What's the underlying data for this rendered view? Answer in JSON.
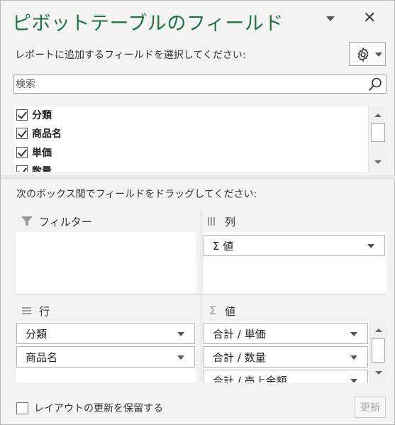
{
  "header": {
    "title": "ピボットテーブルのフィールド",
    "close_glyph": "✕"
  },
  "subtitle": "レポートに追加するフィールドを選択してください:",
  "search": {
    "placeholder": "検索"
  },
  "field_list": [
    {
      "label": "分類",
      "checked": true
    },
    {
      "label": "商品名",
      "checked": true
    },
    {
      "label": "単価",
      "checked": true
    },
    {
      "label": "数量",
      "checked": true
    }
  ],
  "drag_hint": "次のボックス間でフィールドをドラッグしてください:",
  "areas": {
    "filters": {
      "label": "フィルター",
      "icon": "filter-icon",
      "items": []
    },
    "columns": {
      "label": "列",
      "icon": "columns-icon",
      "items": [
        "Σ 値"
      ]
    },
    "rows": {
      "label": "行",
      "icon": "rows-icon",
      "items": [
        "分類",
        "商品名"
      ]
    },
    "values": {
      "label": "値",
      "icon": "sigma-icon",
      "sigma": "Σ",
      "items": [
        "合計 / 単価",
        "合計 / 数量",
        "合計 / 売上金額"
      ]
    }
  },
  "footer": {
    "defer_label": "レイアウトの更新を保留する",
    "defer_checked": false,
    "update_label": "更新"
  },
  "colors": {
    "title": "#217346",
    "background": "#f3f3f3"
  }
}
